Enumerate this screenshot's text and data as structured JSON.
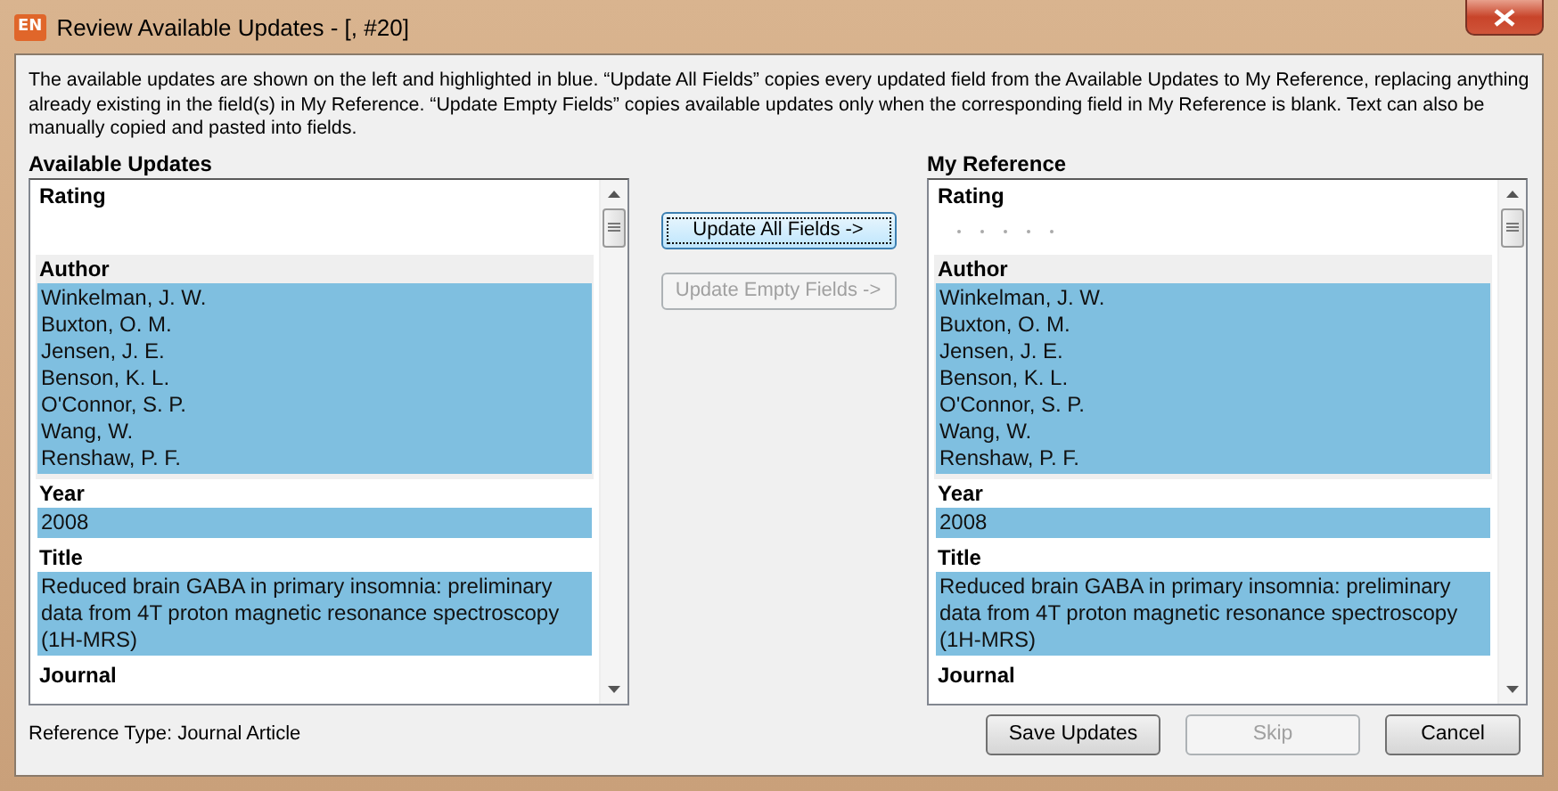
{
  "window": {
    "title": "Review Available Updates - [,  #20]",
    "app_icon": "EN"
  },
  "description": "The available updates are shown on the left and highlighted in blue. “Update All Fields” copies every updated field from the Available Updates to My Reference, replacing anything already existing in the field(s) in My Reference. “Update Empty Fields” copies available updates only when the corresponding field in My Reference is blank. Text can also be manually copied and pasted into fields.",
  "panels": [
    {
      "heading": "Available Updates",
      "fields": [
        {
          "label": "Rating",
          "kind": "rating",
          "focused": false
        },
        {
          "label": "Author",
          "kind": "text",
          "focused": true,
          "highlighted": true,
          "values": [
            "Winkelman, J. W.",
            "Buxton, O. M.",
            "Jensen, J. E.",
            "Benson, K. L.",
            "O'Connor, S. P.",
            "Wang, W.",
            "Renshaw, P. F."
          ]
        },
        {
          "label": "Year",
          "kind": "text",
          "focused": false,
          "highlighted": true,
          "values": [
            "2008"
          ]
        },
        {
          "label": "Title",
          "kind": "text",
          "focused": false,
          "highlighted": true,
          "values": [
            "Reduced brain GABA in primary insomnia: preliminary data from 4T proton magnetic resonance spectroscopy (1H-MRS)"
          ]
        },
        {
          "label": "Journal",
          "kind": "text",
          "focused": false
        }
      ]
    },
    {
      "heading": "My Reference",
      "fields": [
        {
          "label": "Rating",
          "kind": "rating",
          "focused": false,
          "stars": 0
        },
        {
          "label": "Author",
          "kind": "text",
          "focused": true,
          "highlighted": true,
          "values": [
            "Winkelman, J. W.",
            "Buxton, O. M.",
            "Jensen, J. E.",
            "Benson, K. L.",
            "O'Connor, S. P.",
            "Wang, W.",
            "Renshaw, P. F."
          ]
        },
        {
          "label": "Year",
          "kind": "text",
          "focused": false,
          "highlighted": true,
          "values": [
            "2008"
          ]
        },
        {
          "label": "Title",
          "kind": "text",
          "focused": false,
          "highlighted": true,
          "values": [
            "Reduced brain GABA in primary insomnia: preliminary data from 4T proton magnetic resonance spectroscopy (1H-MRS)"
          ]
        },
        {
          "label": "Journal",
          "kind": "text",
          "focused": false
        }
      ]
    }
  ],
  "update_buttons": [
    {
      "label": "Update All Fields ->",
      "disabled": false,
      "default": true
    },
    {
      "label": "Update Empty Fields ->",
      "disabled": true,
      "default": false
    }
  ],
  "reference_type": "Reference Type: Journal Article",
  "footer_buttons": [
    {
      "label": "Save Updates",
      "disabled": false
    },
    {
      "label": "Skip",
      "disabled": true
    },
    {
      "label": "Cancel",
      "disabled": false
    }
  ]
}
